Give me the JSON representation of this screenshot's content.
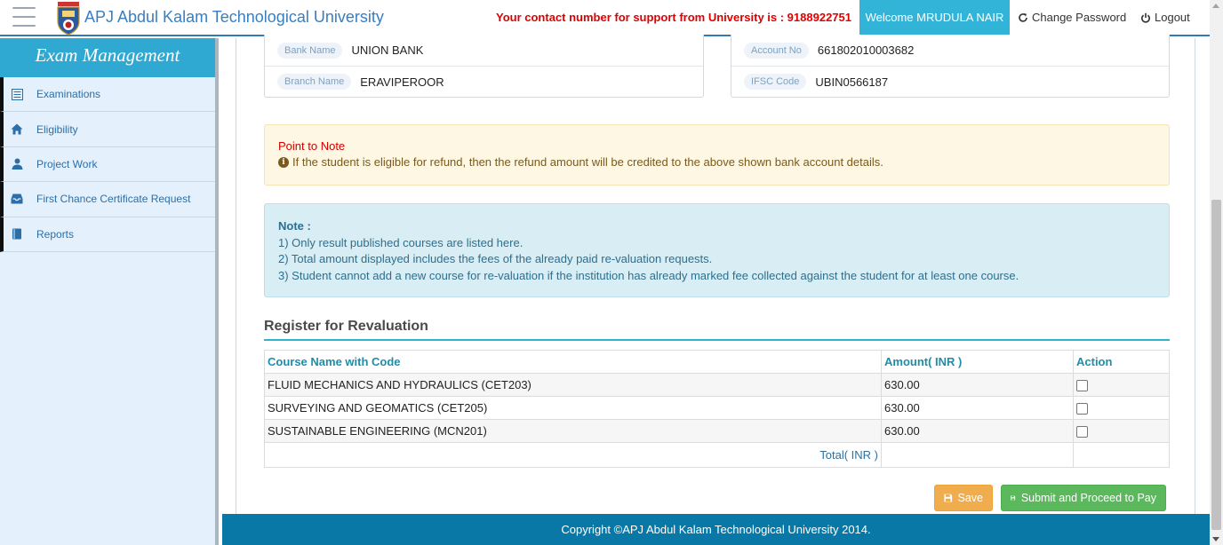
{
  "header": {
    "university_name": "APJ Abdul Kalam Technological University",
    "support_text": "Your contact number for support from University is : 9188922751",
    "welcome_text": "Welcome MRUDULA NAIR",
    "change_password_label": "Change Password",
    "logout_label": "Logout"
  },
  "sidebar": {
    "title": "Exam Management",
    "items": [
      {
        "label": "Examinations",
        "icon": "list-icon"
      },
      {
        "label": "Eligibility",
        "icon": "home-icon"
      },
      {
        "label": "Project Work",
        "icon": "user-icon"
      },
      {
        "label": "First Chance Certificate Request",
        "icon": "inbox-icon"
      },
      {
        "label": "Reports",
        "icon": "book-icon"
      }
    ]
  },
  "bank": {
    "bank_name_label": "Bank Name",
    "bank_name": "UNION BANK",
    "branch_name_label": "Branch Name",
    "branch_name": "ERAVIPEROOR",
    "account_no_label": "Account No",
    "account_no": "661802010003682",
    "ifsc_label": "IFSC Code",
    "ifsc": "UBIN0566187"
  },
  "point_to_note": {
    "title": "Point to Note",
    "message": "If the student is eligible for refund, then the refund amount will be credited to the above shown bank account details."
  },
  "note": {
    "title": "Note :",
    "lines": [
      "1) Only result published courses are listed here.",
      "2) Total amount displayed includes the fees of the already paid re-valuation requests.",
      "3) Student cannot add a new course for re-valuation if the institution has already marked fee collected against the student for at least one course."
    ]
  },
  "revaluation": {
    "section_title": "Register for Revaluation",
    "columns": [
      "Course Name with Code",
      "Amount( INR )",
      "Action"
    ],
    "rows": [
      {
        "course": "FLUID MECHANICS AND HYDRAULICS (CET203)",
        "amount": "630.00",
        "checked": false
      },
      {
        "course": "SURVEYING AND GEOMATICS (CET205)",
        "amount": "630.00",
        "checked": false
      },
      {
        "course": "SUSTAINABLE ENGINEERING (MCN201)",
        "amount": "630.00",
        "checked": false
      }
    ],
    "total_label": "Total( INR )",
    "total_value": ""
  },
  "buttons": {
    "save_label": "Save",
    "submit_label": "Submit and Proceed to Pay"
  },
  "footer": {
    "copyright": "Copyright ©APJ Abdul Kalam Technological University 2014."
  },
  "colors": {
    "accent": "#32b4d8",
    "header_link": "#3a7ec0",
    "support_red": "#e00000",
    "footer_bg": "#0a78a6",
    "save_orange": "#f0ad4e",
    "submit_green": "#5cb85c"
  }
}
